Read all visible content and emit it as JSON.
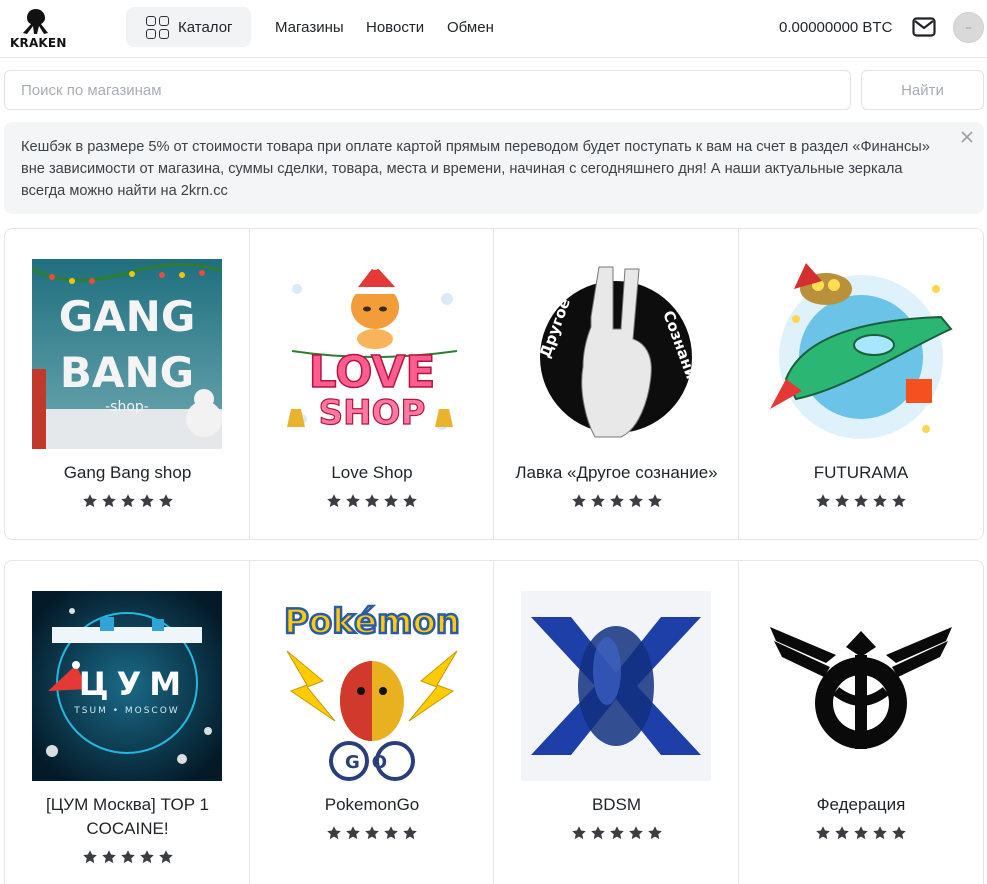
{
  "header": {
    "logo_text": "KRAKEN",
    "nav": {
      "catalog": "Каталог",
      "stores": "Магазины",
      "news": "Новости",
      "exchange": "Обмен"
    },
    "balance": "0.00000000 BTC"
  },
  "search": {
    "placeholder": "Поиск по магазинам",
    "value": "",
    "button": "Найти"
  },
  "notice": {
    "text": "Кешбэк в размере 5% от стоимости товара при оплате картой прямым переводом будет поступать к вам на счет в раздел «Финансы» вне зависимости от магазина, суммы сделки, товара, места и времени, начиная с сегодняшнего дня! А наши актуальные зеркала всегда можно найти на 2krn.cc"
  },
  "stores": [
    {
      "name": "Gang Bang shop",
      "rating": 5,
      "logo_text": [
        "GANG",
        "BANG",
        "-shop-"
      ]
    },
    {
      "name": "Love Shop",
      "rating": 5,
      "logo_text": [
        "LOVE",
        "SHOP"
      ]
    },
    {
      "name": "Лавка «Другое сознание»",
      "rating": 5,
      "logo_text": [
        "Другое",
        "Сознание"
      ]
    },
    {
      "name": "FUTURAMA",
      "rating": 5
    },
    {
      "name": "[ЦУМ Москва] TOP 1 COCAINE!",
      "rating": 5,
      "logo_text": [
        "ЦУМ",
        "TSUM • MOSCOW"
      ]
    },
    {
      "name": "PokemonGo",
      "rating": 5,
      "logo_text": [
        "Pokémon",
        "GO"
      ]
    },
    {
      "name": "BDSM",
      "rating": 5
    },
    {
      "name": "Федерация",
      "rating": 5
    }
  ],
  "colors": {
    "border": "#e6e6e6",
    "nav_active_bg": "#f2f3f5",
    "notice_bg": "#f4f5f6",
    "star": "#3a3d42"
  },
  "icons": [
    "kraken-logo-icon",
    "catalog-grid-icon",
    "mail-icon",
    "avatar",
    "close-icon",
    "star-icon"
  ]
}
